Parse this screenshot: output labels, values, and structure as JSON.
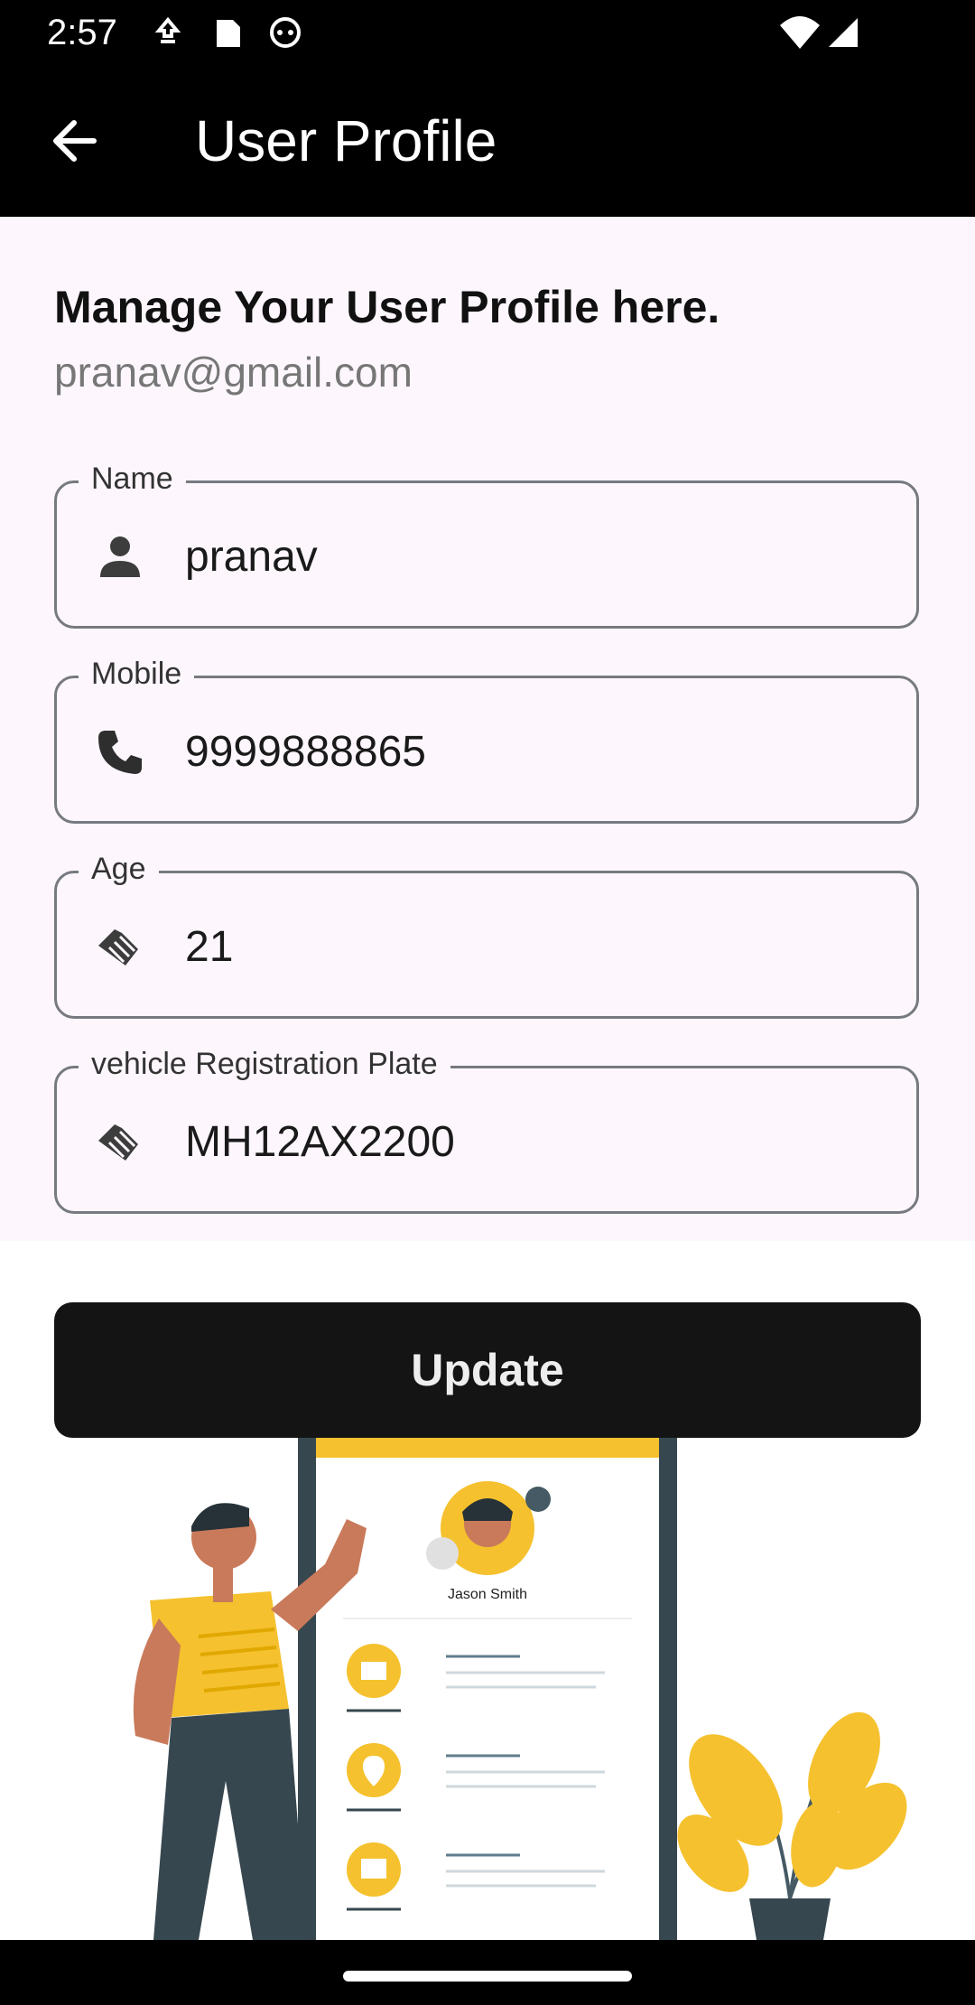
{
  "status_bar": {
    "time": "2:57"
  },
  "app_bar": {
    "title": "User Profile"
  },
  "profile": {
    "heading": "Manage Your User Profile here.",
    "email": "pranav@gmail.com"
  },
  "fields": [
    {
      "label": "Name",
      "value": "pranav",
      "icon": "person-icon"
    },
    {
      "label": "Mobile",
      "value": "9999888865",
      "icon": "phone-icon"
    },
    {
      "label": "Age",
      "value": "21",
      "icon": "handshake-icon"
    },
    {
      "label": "vehicle Registration Plate",
      "value": "MH12AX2200",
      "icon": "handshake-icon"
    }
  ],
  "update_button": {
    "label": "Update"
  },
  "illustration": {
    "sample_name": "Jason Smith"
  },
  "colors": {
    "app_bar": "#000000",
    "content_bg": "#fdf7fd",
    "button_bg": "#141414",
    "accent_yellow": "#f5c12e"
  }
}
